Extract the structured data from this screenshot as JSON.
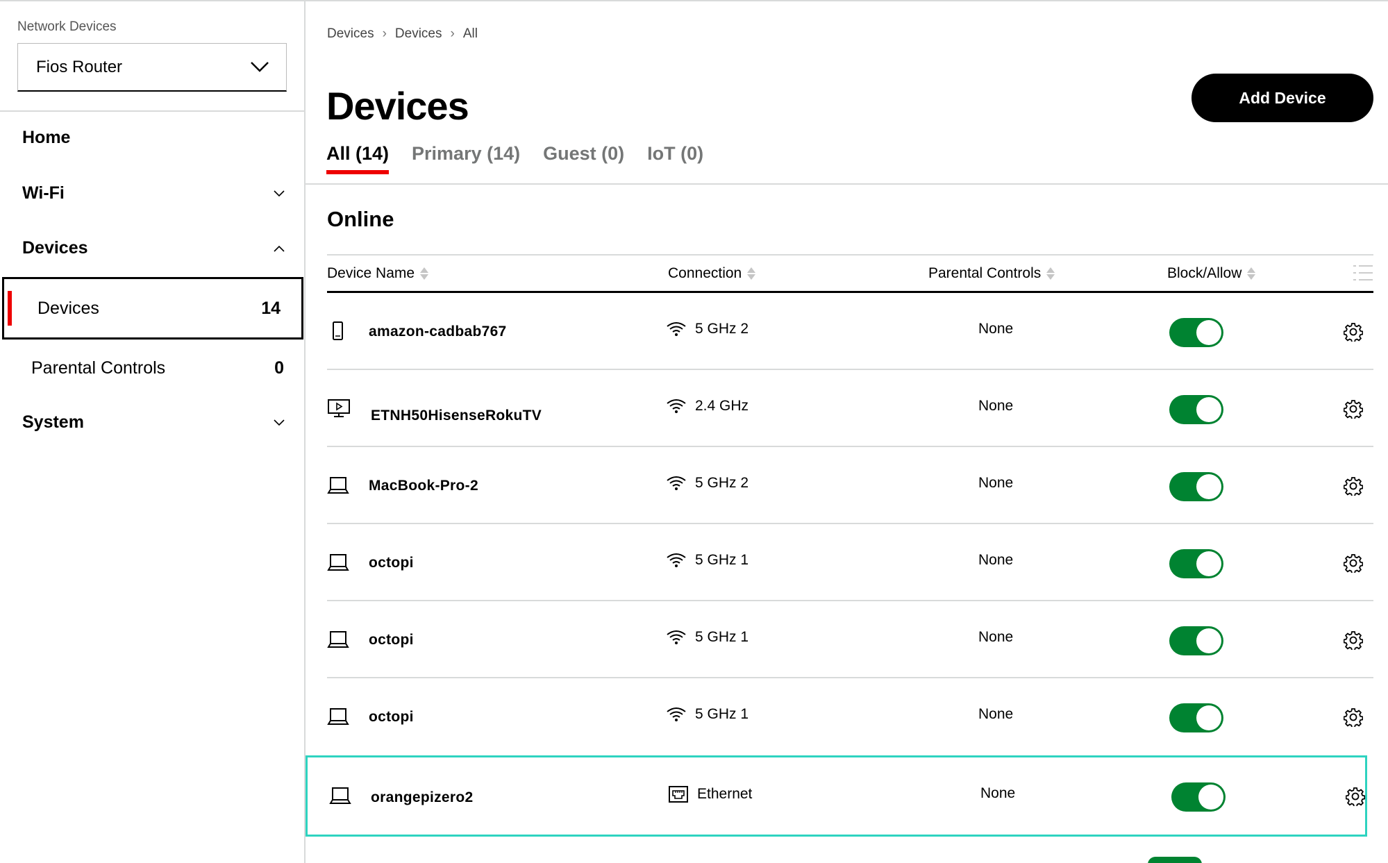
{
  "sidebar": {
    "network_label": "Network Devices",
    "router_selected": "Fios Router",
    "nav": {
      "home": "Home",
      "wifi": "Wi-Fi",
      "devices": "Devices",
      "system": "System"
    },
    "sub_items": [
      {
        "label": "Devices",
        "count": "14"
      },
      {
        "label": "Parental Controls",
        "count": "0"
      }
    ]
  },
  "main": {
    "breadcrumb": [
      "Devices",
      "Devices",
      "All"
    ],
    "title": "Devices",
    "add_button": "Add Device",
    "tabs": [
      "All (14)",
      "Primary (14)",
      "Guest (0)",
      "IoT (0)"
    ],
    "section": "Online",
    "columns": {
      "name": "Device Name",
      "connection": "Connection",
      "parental": "Parental Controls",
      "block": "Block/Allow"
    },
    "rows": [
      {
        "icon": "phone-icon",
        "name": "amazon-cadbab767",
        "conn_icon": "wifi-icon",
        "connection": "5 GHz 2",
        "parental": "None",
        "allowed": true
      },
      {
        "icon": "tv-icon",
        "name": "ETNH50HisenseRokuTV",
        "conn_icon": "wifi-icon",
        "connection": "2.4 GHz",
        "parental": "None",
        "allowed": true
      },
      {
        "icon": "laptop-icon",
        "name": "MacBook-Pro-2",
        "conn_icon": "wifi-icon",
        "connection": "5 GHz 2",
        "parental": "None",
        "allowed": true
      },
      {
        "icon": "laptop-icon",
        "name": "octopi",
        "conn_icon": "wifi-icon",
        "connection": "5 GHz 1",
        "parental": "None",
        "allowed": true
      },
      {
        "icon": "laptop-icon",
        "name": "octopi",
        "conn_icon": "wifi-icon",
        "connection": "5 GHz 1",
        "parental": "None",
        "allowed": true
      },
      {
        "icon": "laptop-icon",
        "name": "octopi",
        "conn_icon": "wifi-icon",
        "connection": "5 GHz 1",
        "parental": "None",
        "allowed": true
      },
      {
        "icon": "laptop-icon",
        "name": "orangepizero2",
        "conn_icon": "ethernet-icon",
        "connection": "Ethernet",
        "parental": "None",
        "allowed": true
      }
    ]
  },
  "colors": {
    "accent": "#ee0000",
    "toggle_on": "#008331",
    "highlight": "#2ed3c0"
  }
}
